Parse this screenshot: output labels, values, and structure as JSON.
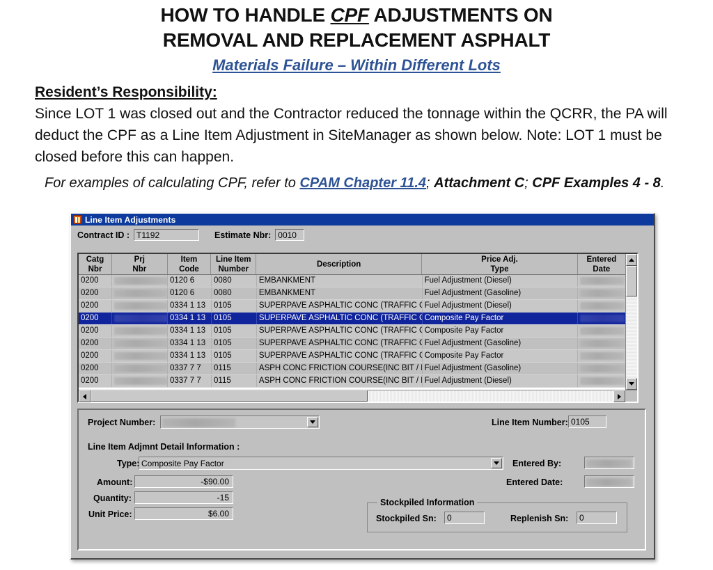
{
  "document": {
    "title_line1_a": "HOW TO HANDLE ",
    "title_line1_em": "CPF",
    "title_line1_b": " ADJUSTMENTS ON",
    "title_line2": "REMOVAL AND REPLACEMENT ASPHALT",
    "subtitle": "Materials Failure – Within Different Lots",
    "responsibility_heading": "Resident’s Responsibility:",
    "paragraph": "Since LOT 1 was closed out and the Contractor reduced the tonnage within the QCRR, the PA will deduct the CPF as a Line Item Adjustment in SiteManager as shown below.  Note: LOT 1 must be closed before this can happen.",
    "examples_prefix": "For examples of calculating CPF, refer to ",
    "examples_link": "CPAM Chapter 11.4",
    "examples_mid": "; ",
    "examples_bold1": "Attachment C",
    "examples_semi": "; ",
    "examples_bold2": "CPF Examples 4 - 8",
    "examples_end": ".",
    "link_color": "#2E5395"
  },
  "window": {
    "title": "Line Item Adjustments",
    "titlebar_color": "#0d3a9c",
    "face_color": "#c0c0c0",
    "header": {
      "contract_id_label": "Contract ID :",
      "contract_id_value": "T1192",
      "estimate_nbr_label": "Estimate Nbr:",
      "estimate_nbr_value": "0010"
    }
  },
  "grid": {
    "columns": [
      {
        "key": "catg",
        "line1": "Catg",
        "line2": "Nbr"
      },
      {
        "key": "prj",
        "line1": "Prj",
        "line2": "Nbr"
      },
      {
        "key": "item",
        "line1": "Item",
        "line2": "Code"
      },
      {
        "key": "line",
        "line1": "Line Item",
        "line2": "Number"
      },
      {
        "key": "desc",
        "line1": "Description",
        "line2": ""
      },
      {
        "key": "type",
        "line1": "Price Adj.",
        "line2": "Type"
      },
      {
        "key": "date",
        "line1": "Entered",
        "line2": "Date"
      }
    ],
    "selected_row_index": 3,
    "selected_row_color": "#10249b",
    "rows": [
      {
        "catg": "0200",
        "prj": "",
        "item": "0120  6",
        "line": "0080",
        "desc": "EMBANKMENT",
        "type": "Fuel Adjustment (Diesel)",
        "date": ""
      },
      {
        "catg": "0200",
        "prj": "",
        "item": "0120  6",
        "line": "0080",
        "desc": "EMBANKMENT",
        "type": "Fuel Adjustment (Gasoline)",
        "date": ""
      },
      {
        "catg": "0200",
        "prj": "",
        "item": "0334  1 13",
        "line": "0105",
        "desc": "SUPERPAVE ASPHALTIC CONC (TRAFFIC C",
        "type": "Fuel Adjustment (Diesel)",
        "date": ""
      },
      {
        "catg": "0200",
        "prj": "",
        "item": "0334  1 13",
        "line": "0105",
        "desc": "SUPERPAVE ASPHALTIC CONC (TRAFFIC C",
        "type": "Composite Pay Factor",
        "date": ""
      },
      {
        "catg": "0200",
        "prj": "",
        "item": "0334  1 13",
        "line": "0105",
        "desc": "SUPERPAVE ASPHALTIC CONC (TRAFFIC C",
        "type": "Composite Pay Factor",
        "date": ""
      },
      {
        "catg": "0200",
        "prj": "",
        "item": "0334  1 13",
        "line": "0105",
        "desc": "SUPERPAVE ASPHALTIC CONC (TRAFFIC C",
        "type": "Fuel Adjustment (Gasoline)",
        "date": ""
      },
      {
        "catg": "0200",
        "prj": "",
        "item": "0334  1 13",
        "line": "0105",
        "desc": "SUPERPAVE ASPHALTIC CONC (TRAFFIC C",
        "type": "Composite Pay Factor",
        "date": ""
      },
      {
        "catg": "0200",
        "prj": "",
        "item": "0337  7  7",
        "line": "0115",
        "desc": "ASPH CONC FRICTION COURSE(INC BIT / F",
        "type": "Fuel Adjustment (Gasoline)",
        "date": ""
      },
      {
        "catg": "0200",
        "prj": "",
        "item": "0337  7  7",
        "line": "0115",
        "desc": "ASPH CONC FRICTION COURSE(INC BIT / F",
        "type": "Fuel Adjustment (Diesel)",
        "date": ""
      }
    ]
  },
  "detail": {
    "project_number_label": "Project Number:",
    "project_number_value": "",
    "line_item_number_label": "Line Item Number:",
    "line_item_number_value": "0105",
    "section_heading": "Line Item Adjmnt Detail Information :",
    "type_label": "Type:",
    "type_value": "Composite Pay Factor",
    "entered_by_label": "Entered By:",
    "entered_by_value": "",
    "entered_date_label": "Entered Date:",
    "entered_date_value": "",
    "amount_label": "Amount:",
    "amount_value": "-$90.00",
    "quantity_label": "Quantity:",
    "quantity_value": "-15",
    "unit_price_label": "Unit Price:",
    "unit_price_value": "$6.00",
    "stockpiled": {
      "group_title": "Stockpiled Information",
      "stockpiled_sn_label": "Stockpiled Sn:",
      "stockpiled_sn_value": "0",
      "replenish_sn_label": "Replenish Sn:",
      "replenish_sn_value": "0"
    }
  }
}
